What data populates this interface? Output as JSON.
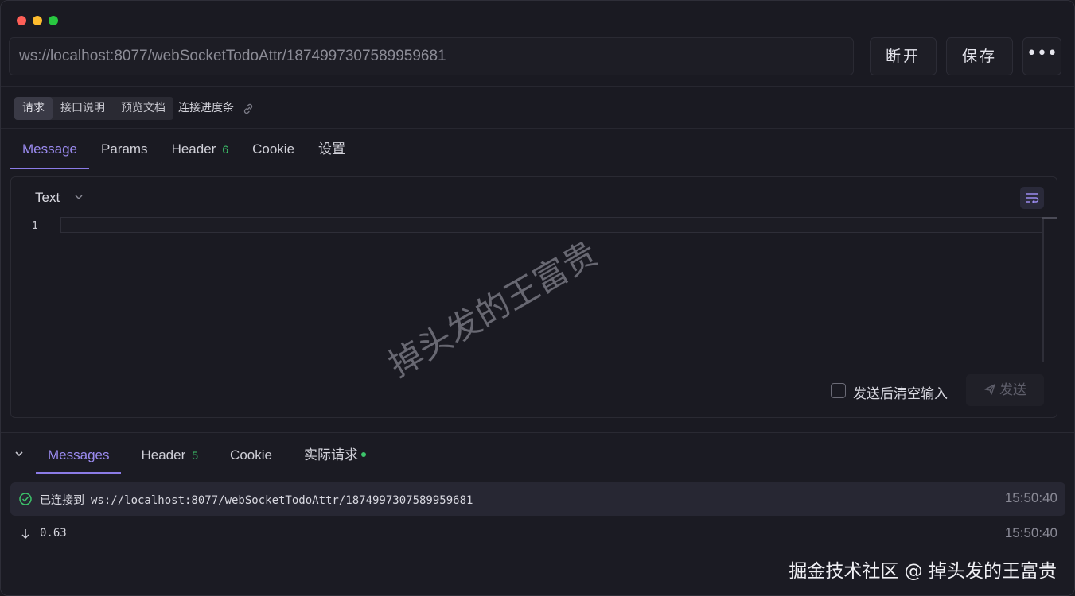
{
  "connection": {
    "url": "ws://localhost:8077/webSocketTodoAttr/1874997307589959681",
    "disconnect_label": "断开",
    "save_label": "保存",
    "more_label": "•••"
  },
  "subtabs": {
    "items": [
      "请求",
      "接口说明",
      "预览文档"
    ],
    "progress_label": "连接进度条"
  },
  "main_tabs": {
    "message": "Message",
    "params": "Params",
    "header": "Header",
    "header_count": "6",
    "cookie": "Cookie",
    "settings": "设置"
  },
  "editor": {
    "body_type": "Text",
    "line_number": "1",
    "clear_after_send_label": "发送后清空输入",
    "send_label": "发送"
  },
  "bottom_tabs": {
    "messages": "Messages",
    "header": "Header",
    "header_count": "5",
    "cookie": "Cookie",
    "actual_request": "实际请求"
  },
  "messages": [
    {
      "status": "已连接到",
      "text": "ws://localhost:8077/webSocketTodoAttr/1874997307589959681",
      "time": "15:50:40",
      "icon": "check-circle-icon"
    },
    {
      "status": "",
      "text": "0.63",
      "time": "15:50:40",
      "icon": "arrow-down-icon"
    }
  ],
  "watermarks": {
    "center": "掉头发的王富贵",
    "corner": "掘金技术社区 @ 掉头发的王富贵"
  },
  "colors": {
    "accent": "#8b7be6",
    "success": "#3cc46a",
    "background": "#1a1a22"
  }
}
